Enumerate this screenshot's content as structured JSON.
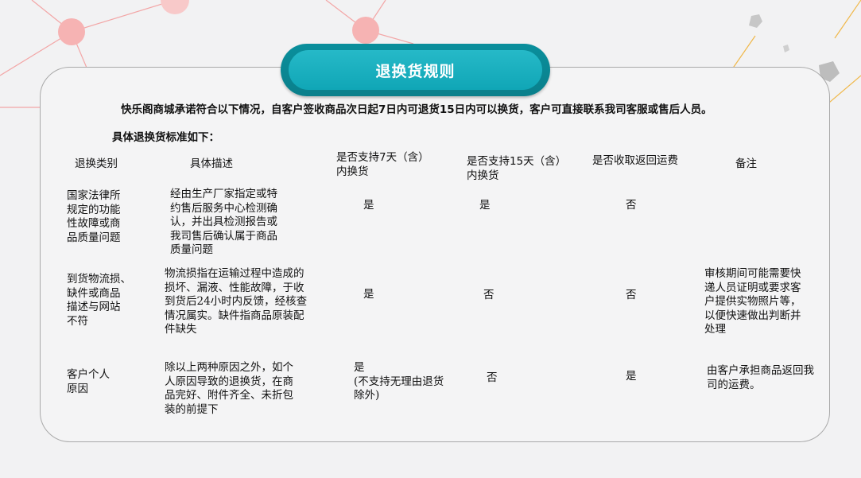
{
  "title": "退换货规则",
  "intro": "快乐阁商城承诺符合以下情况，自客户签收商品次日起7日内可退货15日内可以换货，客户可直接联系我司客服或售后人员。",
  "subheading": "具体退换货标准如下：",
  "table": {
    "headers": {
      "category": "退换类别",
      "description": "具体描述",
      "return7": "是否支持7天（含）\n内换货",
      "exchange15": "是否支持15天（含）\n内换货",
      "shipping_fee": "是否收取返回运费",
      "notes": "备注"
    },
    "rows": [
      {
        "category": "国家法律所\n规定的功能\n性故障或商\n品质量问题",
        "description": "经由生产厂家指定或特\n约售后服务中心检测确\n认，并出具检测报告或\n我司售后确认属于商品\n质量问题",
        "return7": "是",
        "exchange15": "是",
        "shipping_fee": "否",
        "notes": ""
      },
      {
        "category": "到货物流损、\n缺件或商品\n描述与网站\n不符",
        "description": "物流损指在运输过程中造成的\n损坏、漏液、性能故障，于收\n到货后24小时内反馈，经核查\n情况属实。缺件指商品原装配\n件缺失",
        "return7": "是",
        "exchange15": "否",
        "shipping_fee": "否",
        "notes": "审核期间可能需要快\n递人员证明或要求客\n户提供实物照片等，\n以便快速做出判断并\n处理"
      },
      {
        "category": "客户个人\n原因",
        "description": "除以上两种原因之外，如个\n人原因导致的退换货，在商\n品完好、附件齐全、未折包\n装的前提下",
        "return7": "是\n(不支持无理由退货\n除外)",
        "exchange15": "否",
        "shipping_fee": "是",
        "notes": "由客户承担商品返回我\n司的运费。"
      }
    ]
  }
}
